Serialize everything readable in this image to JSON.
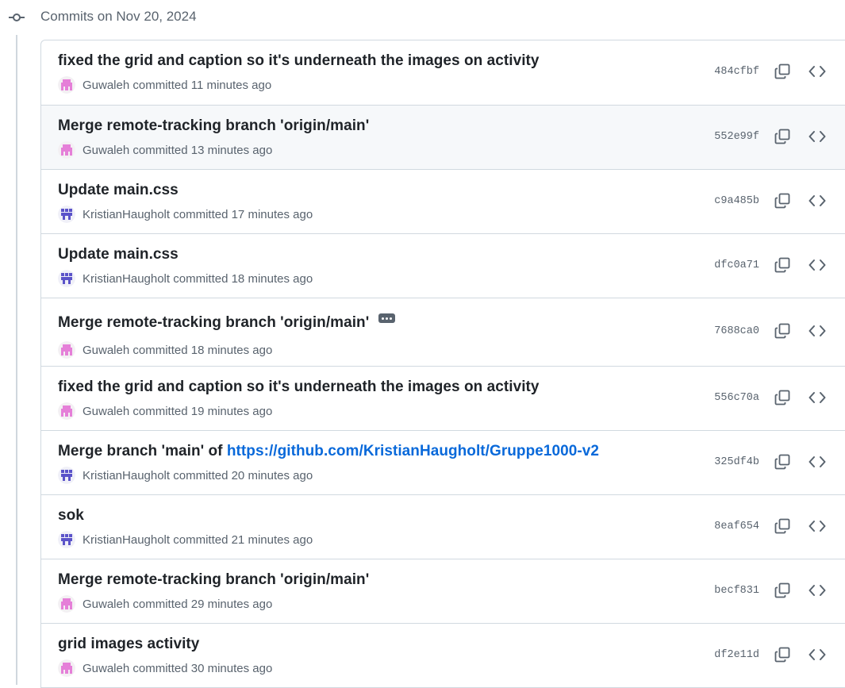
{
  "group": {
    "title": "Commits on Nov 20, 2024"
  },
  "commits": [
    {
      "title": "fixed the grid and caption so it's underneath the images on activity",
      "link": "",
      "author": "Guwaleh",
      "action": "committed",
      "time": "11 minutes ago",
      "sha": "484cfbf",
      "avatar": "pink",
      "ellipsis": false
    },
    {
      "title": "Merge remote-tracking branch 'origin/main'",
      "link": "",
      "author": "Guwaleh",
      "action": "committed",
      "time": "13 minutes ago",
      "sha": "552e99f",
      "avatar": "pink",
      "ellipsis": false
    },
    {
      "title": "Update main.css",
      "link": "",
      "author": "KristianHaugholt",
      "action": "committed",
      "time": "17 minutes ago",
      "sha": "c9a485b",
      "avatar": "blue",
      "ellipsis": false
    },
    {
      "title": "Update main.css",
      "link": "",
      "author": "KristianHaugholt",
      "action": "committed",
      "time": "18 minutes ago",
      "sha": "dfc0a71",
      "avatar": "blue",
      "ellipsis": false
    },
    {
      "title": "Merge remote-tracking branch 'origin/main'",
      "link": "",
      "author": "Guwaleh",
      "action": "committed",
      "time": "18 minutes ago",
      "sha": "7688ca0",
      "avatar": "pink",
      "ellipsis": true
    },
    {
      "title": "fixed the grid and caption so it's underneath the images on activity",
      "link": "",
      "author": "Guwaleh",
      "action": "committed",
      "time": "19 minutes ago",
      "sha": "556c70a",
      "avatar": "pink",
      "ellipsis": false
    },
    {
      "title": "Merge branch 'main' of ",
      "link": "https://github.com/KristianHaugholt/Gruppe1000-v2",
      "author": "KristianHaugholt",
      "action": "committed",
      "time": "20 minutes ago",
      "sha": "325df4b",
      "avatar": "blue",
      "ellipsis": false
    },
    {
      "title": "sok",
      "link": "",
      "author": "KristianHaugholt",
      "action": "committed",
      "time": "21 minutes ago",
      "sha": "8eaf654",
      "avatar": "blue",
      "ellipsis": false
    },
    {
      "title": "Merge remote-tracking branch 'origin/main'",
      "link": "",
      "author": "Guwaleh",
      "action": "committed",
      "time": "29 minutes ago",
      "sha": "becf831",
      "avatar": "pink",
      "ellipsis": false
    },
    {
      "title": "grid images activity",
      "link": "",
      "author": "Guwaleh",
      "action": "committed",
      "time": "30 minutes ago",
      "sha": "df2e11d",
      "avatar": "pink",
      "ellipsis": false
    }
  ],
  "icons": {
    "group": "git-commit-icon",
    "copy": "copy-icon",
    "browse": "code-icon",
    "ellipsis": "kebab-horizontal-icon"
  },
  "colors": {
    "pink_avatar": "#e57fd8",
    "blue_avatar": "#5b53c9",
    "link": "#0969da",
    "hover_row": "#f6f8fa"
  }
}
